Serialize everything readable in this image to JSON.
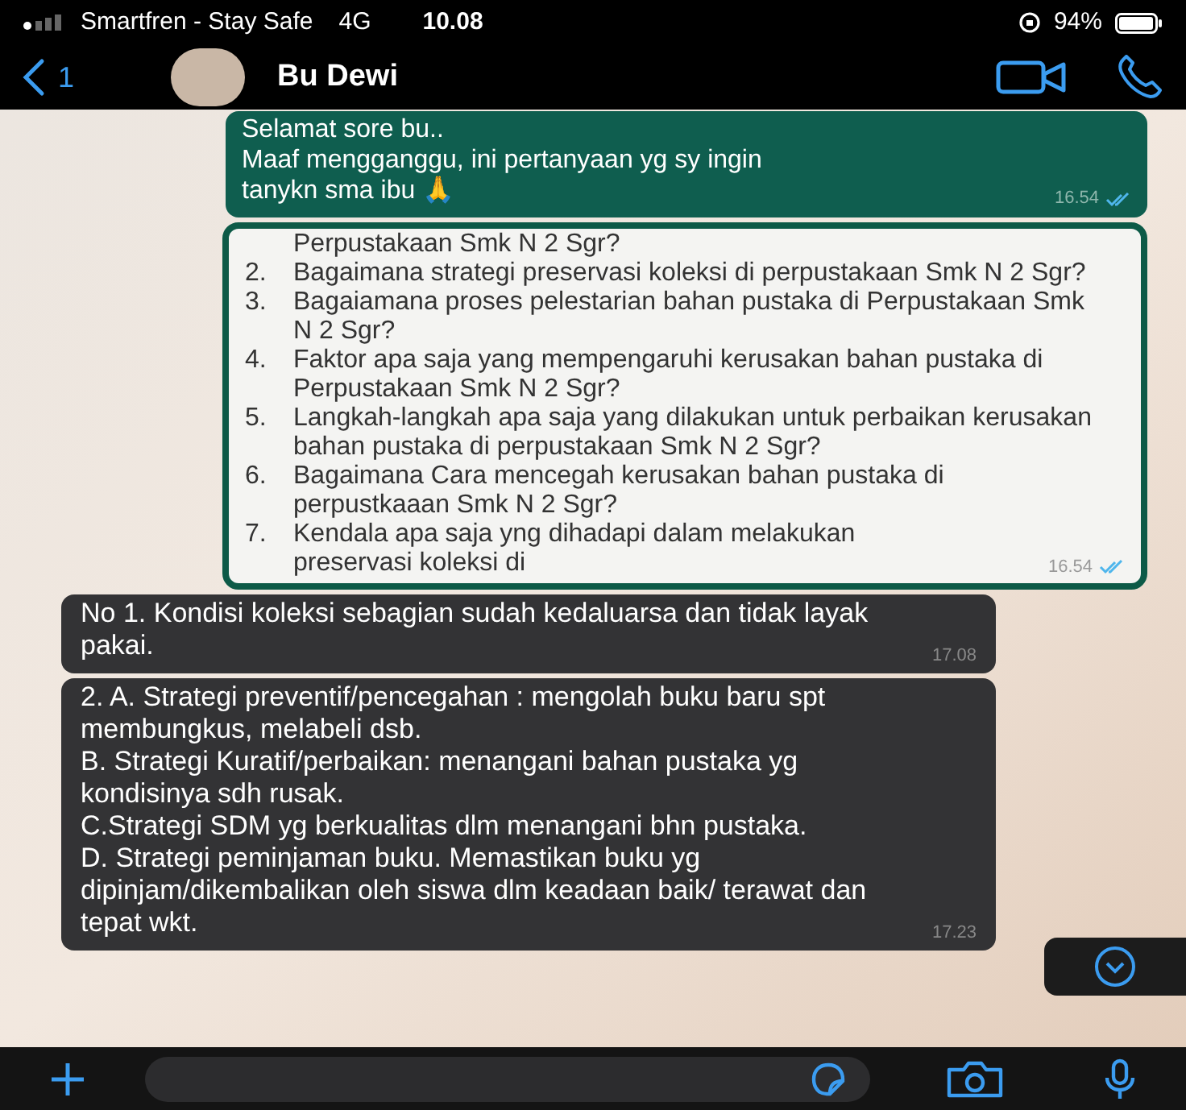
{
  "status_bar": {
    "carrier": "Smartfren - Stay Safe",
    "network": "4G",
    "time": "10.08",
    "battery": "94%"
  },
  "header": {
    "back_count": "1",
    "contact": "Bu Dewi"
  },
  "messages": [
    {
      "kind": "outgoing",
      "lines": [
        "Selamat sore bu..",
        "Maaf mengganggu, ini pertanyaan yg sy ingin",
        "tanykn sma ibu 🙏"
      ],
      "time": "16.54",
      "read": true
    },
    {
      "kind": "quoted_list",
      "items": [
        {
          "text": "Perpustakaan Smk N 2 Sgr?"
        },
        {
          "number": "2.",
          "text": "Bagaimana strategi preservasi koleksi di perpustakaan Smk N 2 Sgr?"
        },
        {
          "number": "3.",
          "text": "Bagaiamana proses pelestarian bahan pustaka di Perpustakaan Smk N 2  Sgr?"
        },
        {
          "number": "4.",
          "text": "Faktor apa saja yang mempengaruhi kerusakan bahan pustaka di Perpustakaan Smk N 2 Sgr?"
        },
        {
          "number": "5.",
          "text": "Langkah-langkah apa saja yang dilakukan untuk perbaikan kerusakan bahan pustaka di perpustakaan Smk N 2 Sgr?"
        },
        {
          "number": "6.",
          "text": "Bagaimana Cara mencegah kerusakan bahan pustaka di perpustkaaan Smk N 2 Sgr?"
        },
        {
          "number": "7.",
          "text": "Kendala apa saja yng dihadapi dalam melakukan preservasi koleksi di"
        }
      ],
      "time": "16.54",
      "read": true
    },
    {
      "kind": "incoming",
      "lines": [
        "No 1. Kondisi koleksi sebagian sudah kedaluarsa dan tidak layak pakai."
      ],
      "time": "17.08"
    },
    {
      "kind": "incoming",
      "lines": [
        "2. A. Strategi preventif/pencegahan : mengolah buku baru spt membungkus, melabeli dsb.",
        "B. Strategi Kuratif/perbaikan: menangani bahan pustaka yg kondisinya sdh rusak.",
        "C.Strategi SDM yg berkualitas dlm menangani bhn pustaka.",
        "D. Strategi peminjaman buku. Memastikan buku yg dipinjam/dikembalikan oleh siswa dlm keadaan baik/ terawat dan tepat wkt."
      ],
      "time": "17.23"
    }
  ]
}
